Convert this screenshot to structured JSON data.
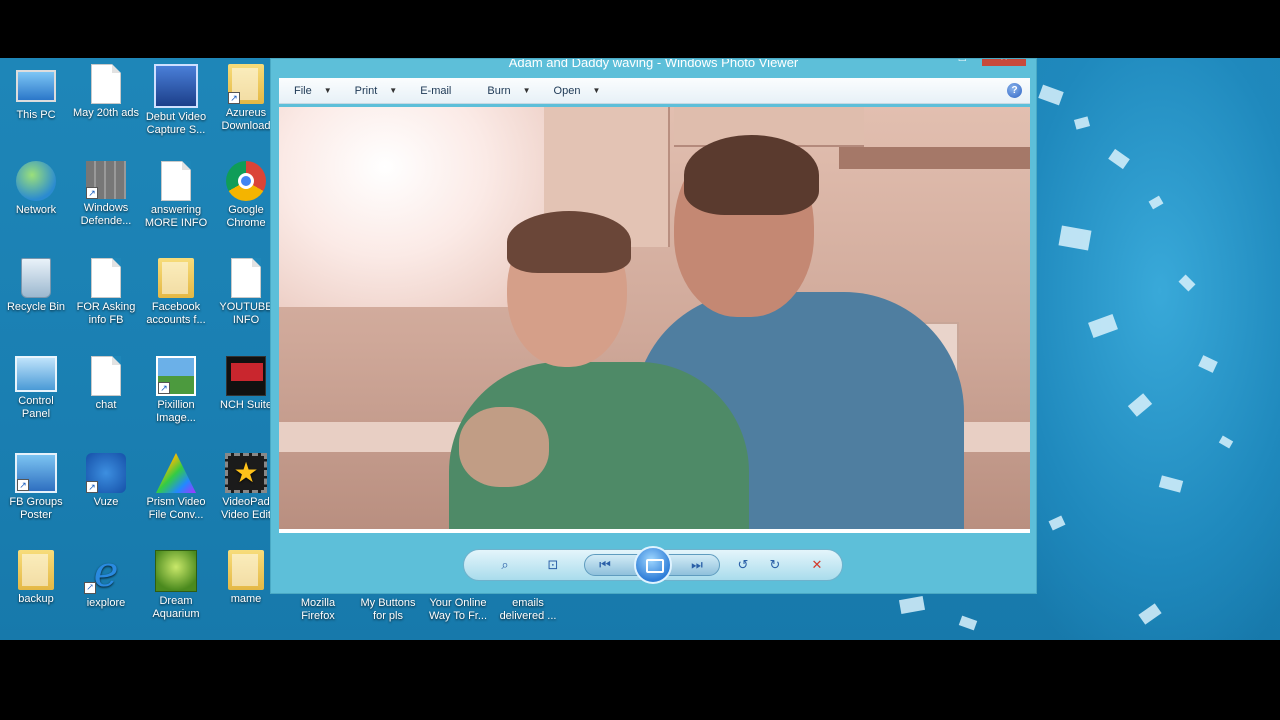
{
  "desktop": {
    "icons": [
      {
        "label": "This PC",
        "icon": "computer-icon"
      },
      {
        "label": "May 20th ads",
        "icon": "document-icon"
      },
      {
        "label": "Debut Video\nCapture S...",
        "icon": "video-capture-icon"
      },
      {
        "label": "Azureus\nDownload",
        "icon": "folder-icon"
      },
      {
        "label": "Network",
        "icon": "network-icon"
      },
      {
        "label": "Windows\nDefende...",
        "icon": "defender-icon"
      },
      {
        "label": "answering\nMORE INFO",
        "icon": "document-icon"
      },
      {
        "label": "Google\nChrome",
        "icon": "chrome-icon"
      },
      {
        "label": "Recycle Bin",
        "icon": "recycle-bin-icon"
      },
      {
        "label": "FOR Asking\ninfo FB",
        "icon": "document-icon"
      },
      {
        "label": "Facebook\naccounts f...",
        "icon": "folder-icon"
      },
      {
        "label": "YOUTUBE\nINFO",
        "icon": "document-icon"
      },
      {
        "label": "Control\nPanel",
        "icon": "control-panel-icon"
      },
      {
        "label": "chat",
        "icon": "document-icon"
      },
      {
        "label": "Pixillion\nImage...",
        "icon": "pixillion-icon"
      },
      {
        "label": "NCH Suite",
        "icon": "nch-icon"
      },
      {
        "label": "FB Groups\nPoster",
        "icon": "fb-poster-icon"
      },
      {
        "label": "Vuze",
        "icon": "vuze-icon"
      },
      {
        "label": "Prism Video\nFile Conv...",
        "icon": "prism-icon"
      },
      {
        "label": "VideoPad\nVideo Edit",
        "icon": "videopad-icon"
      },
      {
        "label": "backup",
        "icon": "folder-icon"
      },
      {
        "label": "iexplore",
        "icon": "ie-icon"
      },
      {
        "label": "Dream\nAquarium",
        "icon": "aquarium-icon"
      },
      {
        "label": "mame",
        "icon": "folder-icon"
      },
      {
        "label": "Mozilla\nFirefox",
        "icon": "firefox-icon"
      },
      {
        "label": "My Buttons\nfor pls",
        "icon": "document-icon"
      },
      {
        "label": "Your Online\nWay To Fr...",
        "icon": "document-icon"
      },
      {
        "label": "emails\ndelivered ...",
        "icon": "document-icon"
      }
    ]
  },
  "window": {
    "title": "Adam and Daddy waving - Windows Photo Viewer",
    "menu": {
      "file": "File",
      "print": "Print",
      "email": "E-mail",
      "burn": "Burn",
      "open": "Open"
    },
    "help_glyph": "?"
  },
  "controls": {
    "zoom": "⌕",
    "fit": "⊡",
    "prev": "⏮",
    "next": "⏭",
    "rotate_ccw": "↺",
    "rotate_cw": "↻",
    "delete": "✕"
  }
}
